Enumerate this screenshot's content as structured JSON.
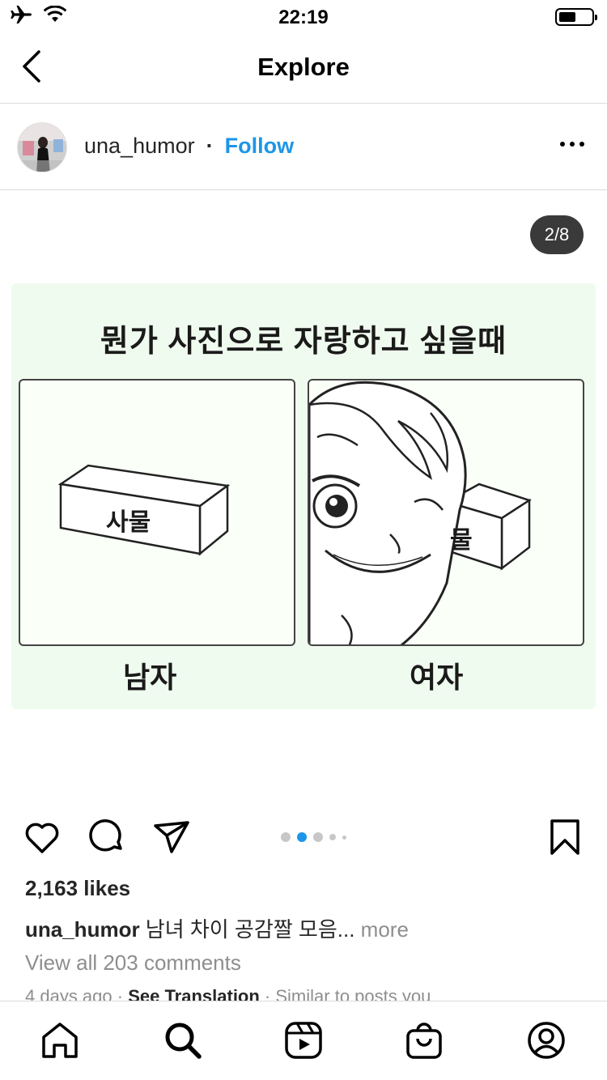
{
  "status_bar": {
    "time": "22:19"
  },
  "header": {
    "title": "Explore"
  },
  "post": {
    "username": "una_humor",
    "separator": "·",
    "follow_label": "Follow",
    "counter": "2/8",
    "image": {
      "title": "뭔가 사진으로 자랑하고 싶을때",
      "box_label": "사물",
      "box_label_right": "물",
      "caption_left": "남자",
      "caption_right": "여자"
    },
    "carousel": {
      "total_dots": 5,
      "active_index": 1
    },
    "likes": "2,163 likes",
    "caption_user": "una_humor",
    "caption_text": " 남녀 차이 공감짤 모음...",
    "caption_more": " more",
    "view_comments": "View all 203 comments",
    "meta": {
      "age": "4 days ago · ",
      "see_translation": "See Translation",
      "similar": " · Similar to posts you"
    }
  },
  "tabs": [
    "home-icon",
    "search-icon",
    "reels-icon",
    "shop-icon",
    "profile-icon"
  ],
  "colors": {
    "accent": "#1c96e8",
    "counter_bg": "#3a3a3a",
    "comic_bg": "#f0fbef"
  }
}
